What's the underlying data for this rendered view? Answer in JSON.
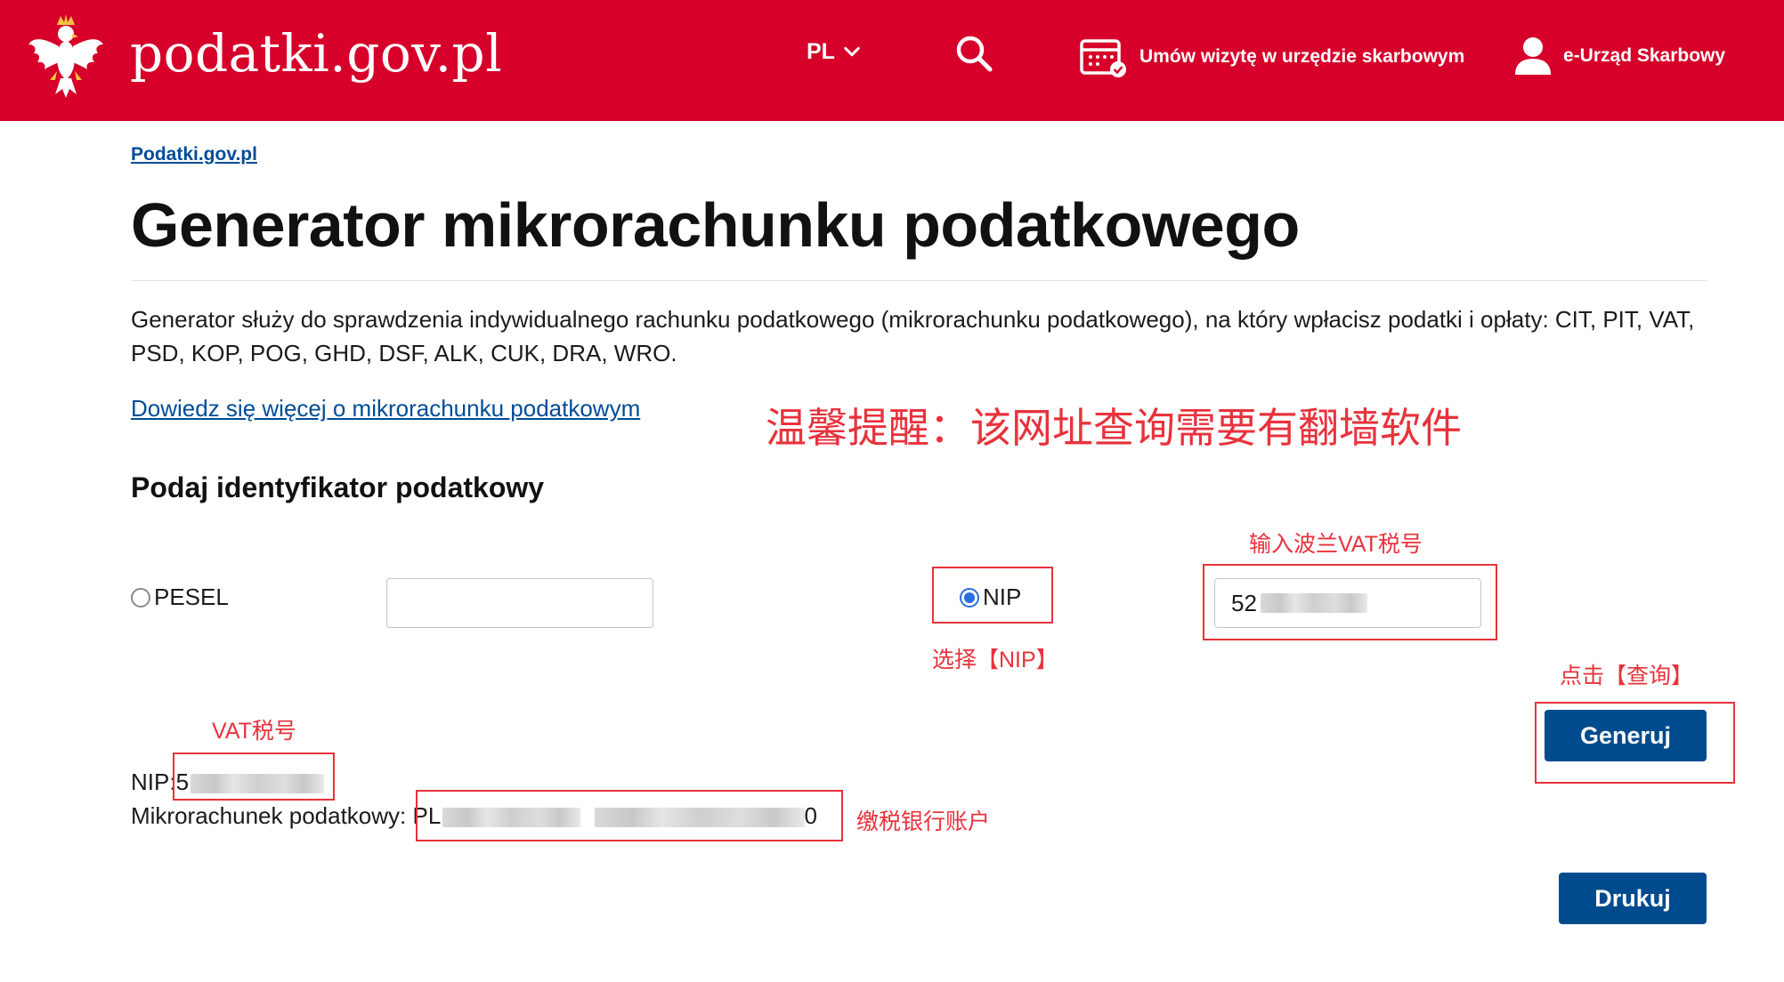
{
  "header": {
    "site_name": "podatki.gov.pl",
    "language": "PL",
    "visit_label": "Umów wizytę w urzędzie skarbowym",
    "eurzad_label": "e-Urząd Skarbowy",
    "brand_color": "#d6002a"
  },
  "breadcrumb": "Podatki.gov.pl",
  "page_title": "Generator mikrorachunku podatkowego",
  "description": "Generator służy do sprawdzenia indywidualnego rachunku podatkowego (mikrorachunku podatkowego), na który wpłacisz podatki i opłaty: CIT, PIT, VAT, PSD, KOP, POG, GHD, DSF, ALK, CUK, DRA, WRO.",
  "more_link": "Dowiedz się więcej o mikrorachunku podatkowym",
  "section_heading": "Podaj identyfikator podatkowy",
  "form": {
    "pesel_label": "PESEL",
    "pesel_value": "",
    "nip_label": "NIP",
    "nip_value": "52",
    "selected": "NIP",
    "generate_button": "Generuj",
    "print_button": "Drukuj"
  },
  "result": {
    "nip_label": "NIP:",
    "nip_value_prefix": "5",
    "account_label": "Mikrorachunek podatkowy:",
    "account_prefix": "PL",
    "account_suffix": "0"
  },
  "annotations": {
    "warning": "温馨提醒：该网址查询需要有翻墙软件",
    "enter_vat": "输入波兰VAT税号",
    "select_nip": "选择【NIP】",
    "click_query": "点击【查询】",
    "vat_number": "VAT税号",
    "bank_account": "缴税银行账户",
    "color": "#e8323c"
  },
  "colors": {
    "primary_button": "#004b8d",
    "link": "#004c98"
  }
}
